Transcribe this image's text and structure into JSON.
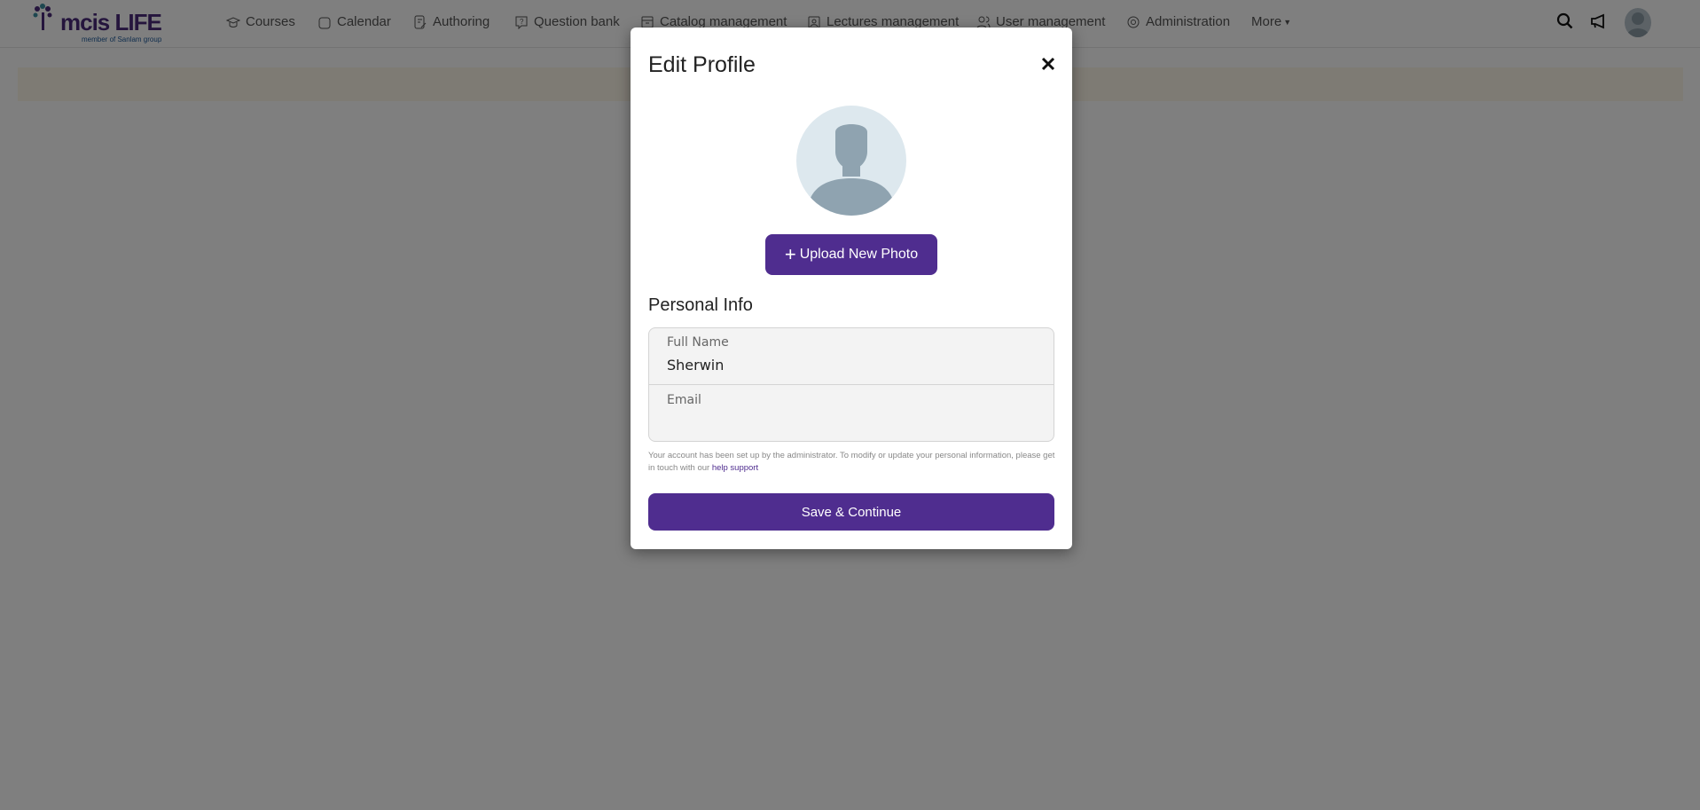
{
  "header": {
    "logo_text": "mcis LIFE",
    "logo_sub": "member of Sanlam group",
    "nav": [
      {
        "label": "Courses",
        "icon": "graduation-cap-icon"
      },
      {
        "label": "Calendar",
        "icon": "calendar-icon"
      },
      {
        "label": "Authoring",
        "icon": "authoring-icon"
      },
      {
        "label": "Question bank",
        "icon": "question-bubble-icon"
      },
      {
        "label": "Catalog management",
        "icon": "archive-icon"
      },
      {
        "label": "Lectures management",
        "icon": "lecture-icon"
      },
      {
        "label": "User management",
        "icon": "users-icon"
      },
      {
        "label": "Administration",
        "icon": "gear-icon"
      },
      {
        "label": "More",
        "icon": "caret-down-icon"
      }
    ]
  },
  "modal": {
    "title": "Edit Profile",
    "upload_label": "Upload New Photo",
    "section_title": "Personal Info",
    "full_name_label": "Full Name",
    "full_name_value": "Sherwin",
    "email_label": "Email",
    "email_value": "",
    "note": "Your account has been set up by the administrator. To modify or update your personal information, please get in touch with our ",
    "note_link": "help support",
    "save_label": "Save & Continue"
  },
  "colors": {
    "accent": "#4f2d8f",
    "overlay": "rgba(0,0,0,0.5)"
  }
}
